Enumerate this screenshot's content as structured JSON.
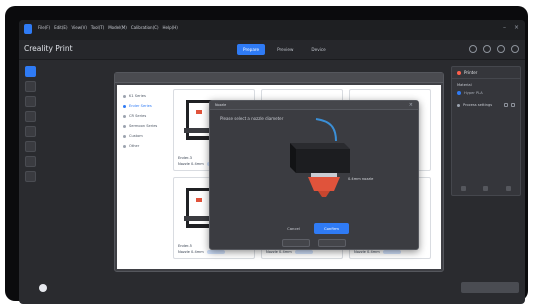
{
  "app": {
    "title": "Creality Print",
    "menu": [
      "File(F)",
      "Edit(E)",
      "View(V)",
      "Tool(T)",
      "Model(M)",
      "Calibration(C)",
      "Help(H)"
    ]
  },
  "toolbar": {
    "tabs": [
      {
        "label": "Prepare",
        "active": true
      },
      {
        "label": "Preview",
        "active": false
      },
      {
        "label": "Device",
        "active": false
      }
    ]
  },
  "right_panel": {
    "title": "Printer",
    "section": "Material",
    "material": "Hyper PLA",
    "process": "Process settings"
  },
  "printer_window": {
    "sidebar": [
      {
        "label": "K1 Series",
        "active": false
      },
      {
        "label": "Ender Series",
        "active": true
      },
      {
        "label": "CR Series",
        "active": false
      },
      {
        "label": "Sermoon Series",
        "active": false
      },
      {
        "label": "Custom",
        "active": false
      },
      {
        "label": "Other",
        "active": false
      }
    ],
    "cards": [
      {
        "name": "Ender-3",
        "spec": "Nozzle 0.4mm"
      },
      {
        "name": "Ender-3 V3",
        "spec": "Nozzle 0.4mm"
      },
      {
        "name": "Ender-3 S1",
        "spec": "Nozzle 0.4mm"
      },
      {
        "name": "Ender-5",
        "spec": "Nozzle 0.4mm"
      },
      {
        "name": "Ender-5 S1",
        "spec": "Nozzle 0.4mm"
      },
      {
        "name": "Ender-7",
        "spec": "Nozzle 0.4mm"
      }
    ]
  },
  "modal": {
    "title": "Nozzle",
    "instruction": "Please select a nozzle diameter",
    "nozzle_label": "0.4mm nozzle",
    "cancel_label": "Cancel",
    "confirm_label": "Confirm"
  },
  "colors": {
    "accent": "#2f7bf5",
    "nozzle_tip": "#e0533b",
    "filament": "#3b8fd6"
  }
}
